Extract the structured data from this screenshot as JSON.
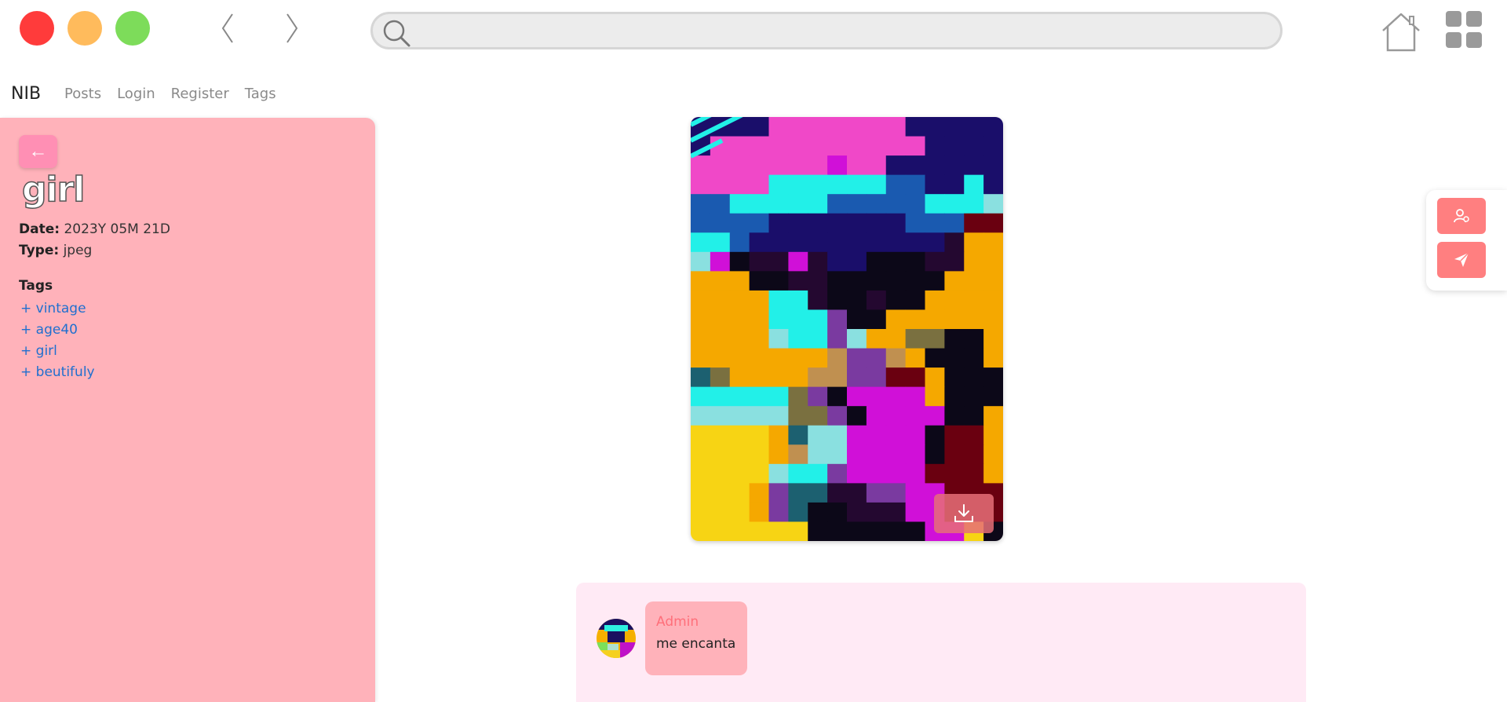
{
  "browser": {
    "address_value": "",
    "icons": {
      "close": "red-dot",
      "minimize": "yellow-dot",
      "maximize": "green-dot",
      "back": "chevron-left-icon",
      "forward": "chevron-right-icon",
      "search": "search-icon",
      "home": "home-icon",
      "apps": "grid-icon"
    },
    "colors": {
      "close": "#ff3b3b",
      "minimize": "#ffbb5c",
      "maximize": "#7ddc5a"
    }
  },
  "site_nav": {
    "brand": "NIB",
    "links": [
      "Posts",
      "Login",
      "Register",
      "Tags"
    ]
  },
  "sidebar": {
    "back_label": "←",
    "title": "girl",
    "date_label": "Date:",
    "date_value": "2023Y 05M 21D",
    "type_label": "Type:",
    "type_value": "jpeg",
    "tags_heading": "Tags",
    "tags": [
      "+ vintage",
      "+ age40",
      "+ girl",
      "+ beutifuly"
    ],
    "color": "#ffb2ba"
  },
  "main_image": {
    "alt": "pixelated colorful image",
    "download_icon": "download-icon"
  },
  "float_actions": {
    "user_icon": "user-settings-icon",
    "send_icon": "send-icon",
    "color": "#ff7f80"
  },
  "comments": [
    {
      "author": "Admin",
      "text": "me encanta"
    }
  ]
}
